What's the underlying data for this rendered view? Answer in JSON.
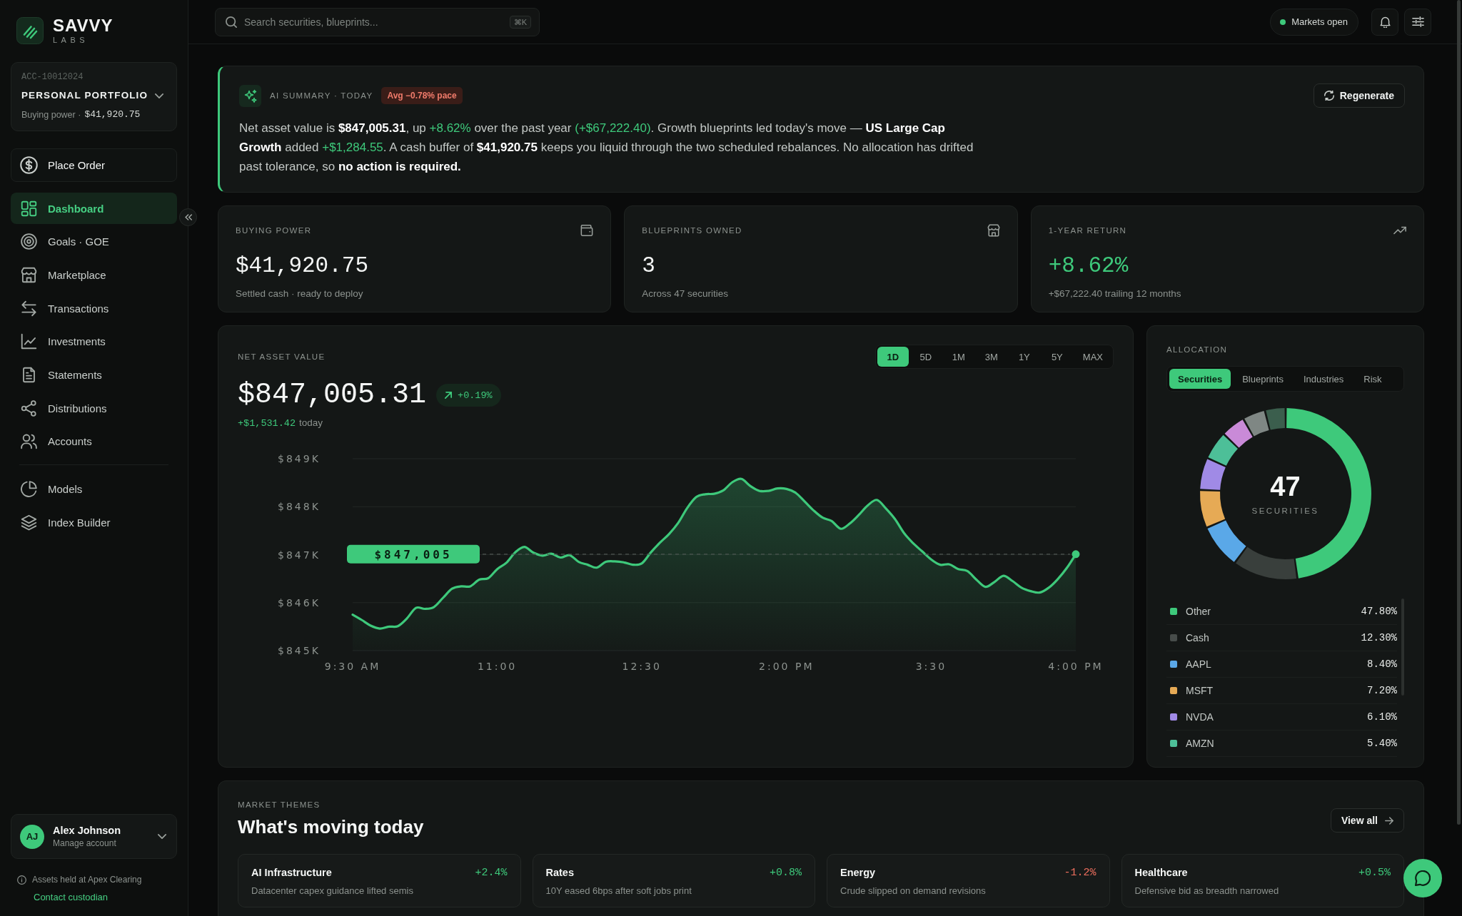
{
  "sidebar": {
    "brand": {
      "name": "SAVVY",
      "tagline": "LABS"
    },
    "account": {
      "id": "ACC-10012024",
      "name": "PERSONAL PORTFOLIO",
      "buying_power_label": "Buying power ·",
      "buying_power_value": "$41,920.75"
    },
    "primary_action": "Place Order",
    "nav_groups": [
      {
        "items": [
          {
            "label": "Dashboard",
            "selected": true
          },
          {
            "label": "Goals · GOE",
            "selected": false
          },
          {
            "label": "Marketplace",
            "selected": false
          },
          {
            "label": "Transactions",
            "selected": false
          },
          {
            "label": "Investments",
            "selected": false
          },
          {
            "label": "Statements",
            "selected": false
          },
          {
            "label": "Distributions",
            "selected": false
          },
          {
            "label": "Accounts",
            "selected": false
          }
        ]
      },
      {
        "items": [
          {
            "label": "Models",
            "selected": false
          },
          {
            "label": "Index Builder",
            "selected": false
          }
        ]
      }
    ],
    "user": {
      "initials": "AJ",
      "name": "Alex Johnson",
      "subtitle": "Manage account"
    },
    "custody_note": "Assets held at Apex Clearing",
    "custody_link": "Contact custodian"
  },
  "topbar": {
    "search": {
      "placeholder": "Search securities, blueprints...",
      "shortcut": "⌘K"
    },
    "market_status": {
      "label": "Markets open",
      "open": true
    }
  },
  "ai_summary": {
    "label": "AI SUMMARY · TODAY",
    "badge": "Avg −0.78% pace",
    "action": "Regenerate",
    "segments": [
      {
        "text": "Net asset value is ",
        "kind": "plain"
      },
      {
        "text": "$847,005.31",
        "kind": "strong"
      },
      {
        "text": ", up ",
        "kind": "plain"
      },
      {
        "text": "+8.62%",
        "kind": "gain"
      },
      {
        "text": " over the past year ",
        "kind": "plain"
      },
      {
        "text": "(+$67,222.40)",
        "kind": "gain"
      },
      {
        "text": ". Growth blueprints led today's move — ",
        "kind": "plain"
      },
      {
        "text": "US Large Cap Growth",
        "kind": "strong"
      },
      {
        "text": " added ",
        "kind": "plain"
      },
      {
        "text": "+$1,284.55",
        "kind": "gain"
      },
      {
        "text": ". A cash buffer of ",
        "kind": "plain"
      },
      {
        "text": "$41,920.75",
        "kind": "strong"
      },
      {
        "text": " keeps you liquid through the two scheduled rebalances. No allocation has drifted past tolerance, so ",
        "kind": "plain"
      },
      {
        "text": "no action is required.",
        "kind": "strong"
      }
    ]
  },
  "stats": [
    {
      "label": "BUYING POWER",
      "value": "$41,920.75",
      "gain": false,
      "note": "Settled cash · ready to deploy"
    },
    {
      "label": "BLUEPRINTS OWNED",
      "value": "3",
      "gain": false,
      "note": "Across 47 securities"
    },
    {
      "label": "1-YEAR RETURN",
      "value": "+8.62%",
      "gain": true,
      "note": "+$67,222.40 trailing 12 months"
    }
  ],
  "net_asset_value": {
    "label": "NET ASSET VALUE",
    "value": "$847,005.31",
    "change_percent": "+0.19%",
    "change_amount": "+$1,531.42",
    "change_period": "today",
    "ranges": [
      {
        "label": "1D",
        "selected": true
      },
      {
        "label": "5D",
        "selected": false
      },
      {
        "label": "1M",
        "selected": false
      },
      {
        "label": "3M",
        "selected": false
      },
      {
        "label": "1Y",
        "selected": false
      },
      {
        "label": "5Y",
        "selected": false
      },
      {
        "label": "MAX",
        "selected": false
      }
    ],
    "price_tag": "$847,005",
    "chart_data": {
      "type": "area",
      "categories": [
        "9:30 AM",
        null,
        null,
        null,
        null,
        null,
        null,
        null,
        null,
        null,
        null,
        null,
        null,
        null,
        null,
        null,
        "11:00",
        null,
        null,
        null,
        null,
        null,
        null,
        null,
        null,
        null,
        null,
        null,
        null,
        null,
        null,
        null,
        "12:30",
        null,
        null,
        null,
        null,
        null,
        null,
        null,
        null,
        null,
        null,
        null,
        null,
        null,
        null,
        null,
        "2:00 PM",
        null,
        null,
        null,
        null,
        null,
        null,
        null,
        null,
        null,
        null,
        null,
        null,
        null,
        null,
        null,
        "3:30",
        null,
        null,
        null,
        null,
        null,
        null,
        null,
        null,
        null,
        null,
        null,
        null,
        null,
        null,
        null,
        "4:00 PM"
      ],
      "series": [
        {
          "color": "#3ec97b",
          "values": [
            845750,
            845640,
            845520,
            845460,
            845500,
            845510,
            845670,
            845890,
            845870,
            845910,
            846100,
            846290,
            846340,
            846340,
            846480,
            846510,
            846700,
            846830,
            847050,
            847160,
            847040,
            846980,
            847020,
            846940,
            846990,
            846850,
            846790,
            846730,
            846850,
            846860,
            846840,
            846790,
            846820,
            847050,
            847250,
            847430,
            847660,
            847970,
            848200,
            848260,
            848270,
            848340,
            848510,
            848580,
            848430,
            848330,
            848330,
            848380,
            848370,
            848290,
            848110,
            847920,
            847770,
            847700,
            847540,
            847650,
            847830,
            848030,
            848140,
            847960,
            847740,
            847450,
            847240,
            847070,
            846900,
            846790,
            846800,
            846700,
            846660,
            846480,
            846330,
            846430,
            846560,
            846450,
            846310,
            846240,
            846210,
            846310,
            846490,
            846720,
            847010
          ]
        }
      ],
      "ylim": [
        845000,
        849000
      ],
      "yticks": [
        {
          "value": 849000,
          "label": "$849K"
        },
        {
          "value": 848000,
          "label": "$848K"
        },
        {
          "value": 847000,
          "label": "$847K"
        },
        {
          "value": 846000,
          "label": "$846K"
        },
        {
          "value": 845000,
          "label": "$845K"
        }
      ],
      "grid": true
    }
  },
  "allocation": {
    "label": "ALLOCATION",
    "tabs": [
      {
        "label": "Securities",
        "selected": true
      },
      {
        "label": "Blueprints",
        "selected": false
      },
      {
        "label": "Industries",
        "selected": false
      },
      {
        "label": "Risk",
        "selected": false
      }
    ],
    "center_value": "47",
    "center_label": "SECURITIES",
    "chart_data": {
      "type": "donut",
      "values": [
        47.8,
        12.3,
        8.4,
        7.2,
        6.1,
        5.4,
        4.6,
        4.3,
        3.9
      ],
      "colors": [
        "#3ec97b",
        "#393f3c",
        "#5aa8e8",
        "#e6aa55",
        "#a08ae6",
        "#4dbf98",
        "#c98ad8",
        "#7f8784",
        "#3b5e4d"
      ]
    },
    "legend": [
      {
        "label": "Other",
        "value": "47.80%",
        "color": "#3ec97b"
      },
      {
        "label": "Cash",
        "value": "12.30%",
        "color": "#474c4a"
      },
      {
        "label": "AAPL",
        "value": "8.40%",
        "color": "#5aa8e8"
      },
      {
        "label": "MSFT",
        "value": "7.20%",
        "color": "#e6aa55"
      },
      {
        "label": "NVDA",
        "value": "6.10%",
        "color": "#a08ae6"
      },
      {
        "label": "AMZN",
        "value": "5.40%",
        "color": "#4dbf98"
      }
    ]
  },
  "market_themes": {
    "label": "MARKET THEMES",
    "title": "What's moving today",
    "action": "View all",
    "themes": [
      {
        "name": "AI Infrastructure",
        "change": "+2.4%",
        "gain": true,
        "description": "Datacenter capex guidance lifted semis"
      },
      {
        "name": "Rates",
        "change": "+0.8%",
        "gain": true,
        "description": "10Y eased 6bps after soft jobs print"
      },
      {
        "name": "Energy",
        "change": "-1.2%",
        "gain": false,
        "description": "Crude slipped on demand revisions"
      },
      {
        "name": "Healthcare",
        "change": "+0.5%",
        "gain": true,
        "description": "Defensive bid as breadth narrowed"
      }
    ]
  }
}
